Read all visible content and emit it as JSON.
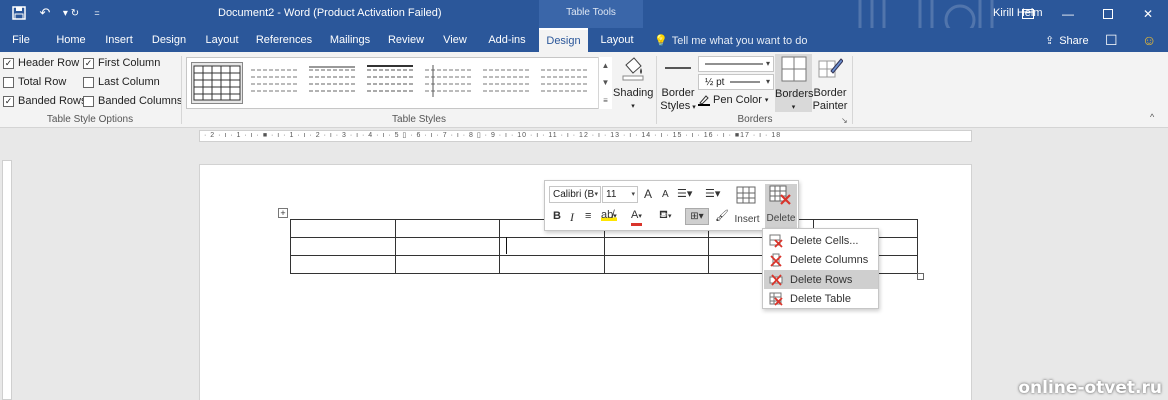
{
  "titlebar": {
    "document_title": "Document2  -  Word (Product Activation Failed)",
    "context_tab": "Table Tools",
    "user": "Kirill Helm",
    "qat_icons": [
      "save-icon",
      "undo-icon",
      "redo-icon",
      "customize-icon"
    ],
    "window_icons": [
      "ribbon-display-icon",
      "minimize-icon",
      "restore-icon",
      "close-icon"
    ]
  },
  "tabs": [
    {
      "label": "File"
    },
    {
      "label": "Home"
    },
    {
      "label": "Insert"
    },
    {
      "label": "Design"
    },
    {
      "label": "Layout"
    },
    {
      "label": "References"
    },
    {
      "label": "Mailings"
    },
    {
      "label": "Review"
    },
    {
      "label": "View"
    },
    {
      "label": "Add-ins"
    },
    {
      "label": "Design"
    },
    {
      "label": "Layout"
    }
  ],
  "tellme": "Tell me what you want to do",
  "share": "Share",
  "ribbon": {
    "style_options": {
      "label": "Table Style Options",
      "header_row": "Header Row",
      "first_column": "First Column",
      "total_row": "Total Row",
      "last_column": "Last Column",
      "banded_rows": "Banded Rows",
      "banded_columns": "Banded Columns"
    },
    "table_styles": {
      "label": "Table Styles",
      "shading": "Shading"
    },
    "borders": {
      "label": "Borders",
      "border_styles_line1": "Border",
      "border_styles_line2": "Styles",
      "weight": "½ pt",
      "pen_color": "Pen Color",
      "borders_btn": "Borders",
      "border_painter_line1": "Border",
      "border_painter_line2": "Painter"
    }
  },
  "ruler": {
    "text": "· 2 · ı · 1 · ı · ■ · ı · 1 · ı · 2 · ı · 3 · ı · 4 · ı · 5 ▯ · 6 · ı · 7 · ı · 8 ▯ · 9 · ı · 10 · ı · 11 · ı · 12 · ı · 13 · ı · 14 · ı · 15 · ı · 16 · ı · ■17 · ı · 18",
    "corner": "L"
  },
  "mini_toolbar": {
    "font_name": "Calibri (B",
    "font_size": "11",
    "grow": "A",
    "shrink": "A",
    "bold": "B",
    "italic": "I",
    "font_color_letter": "A",
    "insert": "Insert",
    "delete": "Delete"
  },
  "delete_menu": [
    {
      "label": "Delete Cells...",
      "icon": "delete-cells-icon"
    },
    {
      "label": "Delete Columns",
      "icon": "delete-columns-icon"
    },
    {
      "label": "Delete Rows",
      "icon": "delete-rows-icon",
      "highlighted": true
    },
    {
      "label": "Delete Table",
      "icon": "delete-table-icon"
    }
  ],
  "table": {
    "rows": 3,
    "cols": 6
  },
  "watermark": "online-otvet.ru",
  "colors": {
    "word_blue": "#2b579a",
    "ribbon_bg": "#f3f3f3",
    "delete_red": "#d9342b"
  }
}
